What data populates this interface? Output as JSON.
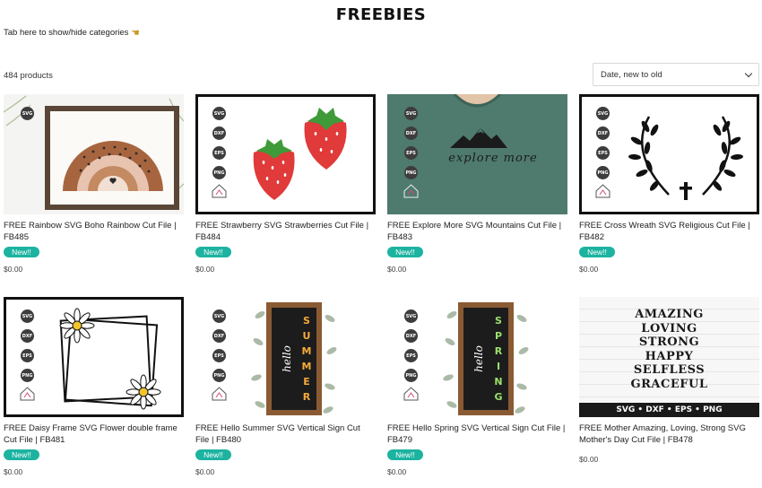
{
  "page": {
    "title": "FREEBIES"
  },
  "categories_toggle": {
    "label": "Tab here to show/hide categories",
    "icon": "pointing-hand-icon"
  },
  "toolbar": {
    "product_count": "484 products",
    "sort_value": "Date, new to old"
  },
  "format_labels": [
    "SVG",
    "DXF",
    "EPS",
    "PNG"
  ],
  "colors": {
    "badge": "#1cb3a0",
    "frame": "#111111"
  },
  "products": [
    {
      "title": "FREE Rainbow SVG Boho Rainbow Cut File | FB485",
      "badge": "New!!",
      "price": "$0.00"
    },
    {
      "title": "FREE Strawberry SVG Strawberries Cut File | FB484",
      "badge": "New!!",
      "price": "$0.00"
    },
    {
      "title": "FREE Explore More SVG Mountains Cut File | FB483",
      "badge": "New!!",
      "price": "$0.00",
      "image_text": "explore more"
    },
    {
      "title": "FREE Cross Wreath SVG Religious Cut File | FB482",
      "badge": "New!!",
      "price": "$0.00"
    },
    {
      "title": "FREE Daisy Frame SVG Flower double frame Cut File | FB481",
      "badge": "New!!",
      "price": "$0.00"
    },
    {
      "title": "FREE Hello Summer SVG Vertical Sign Cut File | FB480",
      "badge": "New!!",
      "price": "$0.00",
      "image_text": {
        "script": "hello",
        "word": "SUMMER"
      }
    },
    {
      "title": "FREE Hello Spring SVG Vertical Sign Cut File | FB479",
      "badge": "New!!",
      "price": "$0.00",
      "image_text": {
        "script": "hello",
        "word": "SPRING"
      }
    },
    {
      "title": "FREE Mother Amazing, Loving, Strong SVG Mother's Day Cut File | FB478",
      "price": "$0.00",
      "image_text": {
        "lines": [
          "AMAZING",
          "LOVING",
          "STRONG",
          "HAPPY",
          "SELFLESS",
          "GRACEFUL"
        ],
        "footer": "SVG • DXF • EPS • PNG"
      }
    }
  ]
}
